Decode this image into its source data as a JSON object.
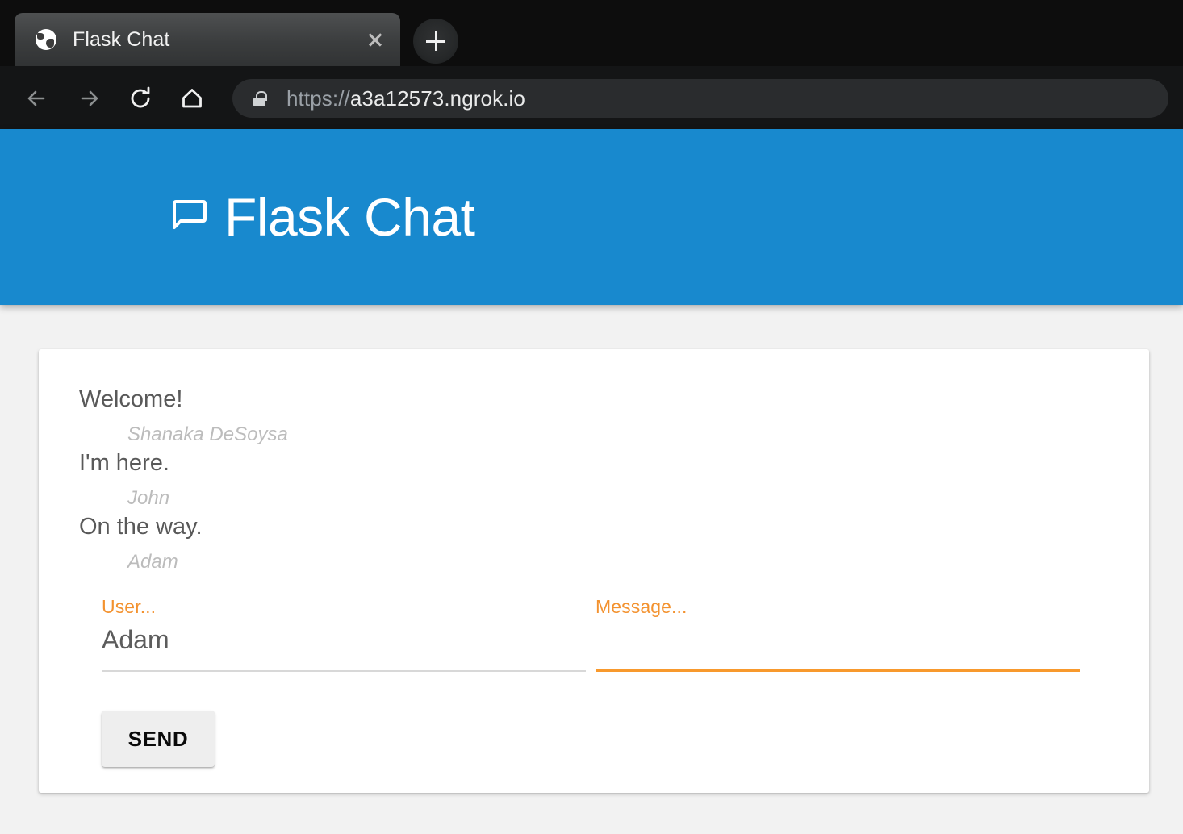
{
  "browser": {
    "tab": {
      "title": "Flask Chat",
      "favicon": "globe-icon",
      "close": "×"
    },
    "new_tab_label": "+",
    "nav": {
      "back": "back-arrow-icon",
      "forward": "forward-arrow-icon",
      "reload": "reload-icon",
      "home": "home-icon"
    },
    "omnibox": {
      "lock": "lock-icon",
      "scheme": "https://",
      "host": "a3a12573.ngrok.io",
      "full_url": "https://a3a12573.ngrok.io"
    }
  },
  "app": {
    "header": {
      "icon": "chat-bubble-icon",
      "title": "Flask Chat",
      "background_color": "#1889ce"
    },
    "messages": [
      {
        "body": "Welcome!",
        "author": "Shanaka DeSoysa"
      },
      {
        "body": "I'm here.",
        "author": "John"
      },
      {
        "body": "On the way.",
        "author": "Adam"
      }
    ],
    "form": {
      "user_field": {
        "label": "User...",
        "value": "Adam",
        "placeholder": "User...",
        "focused": false
      },
      "message_field": {
        "label": "Message...",
        "value": "",
        "placeholder": "Message...",
        "focused": true
      },
      "send_button": "SEND"
    },
    "colors": {
      "accent_blue": "#1889ce",
      "accent_orange": "#f8992d",
      "label_orange": "#f3922f",
      "message_text": "#595959",
      "author_text": "#bcbcbc",
      "page_background": "#f2f2f2"
    }
  }
}
